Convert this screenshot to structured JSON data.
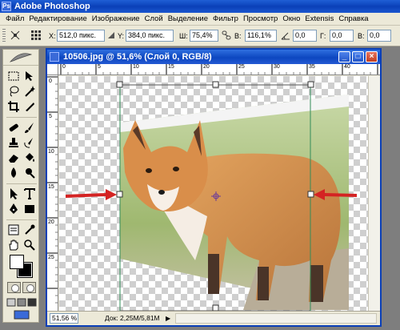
{
  "app": {
    "title": "Adobe Photoshop"
  },
  "menu": [
    "Файл",
    "Редактирование",
    "Изображение",
    "Слой",
    "Выделение",
    "Фильтр",
    "Просмотр",
    "Окно",
    "Extensis",
    "Справка"
  ],
  "options": {
    "x_label": "X:",
    "x_value": "512,0 пикс.",
    "y_label": "Y:",
    "y_value": "384,0 пикс.",
    "w_label": "Ш:",
    "w_value": "75,4%",
    "h_label": "В:",
    "h_value": "116,1%",
    "angle_value": "0,0",
    "hskew_label": "Г:",
    "hskew_value": "0,0",
    "vskew_label": "В:",
    "vskew_value": "0,0"
  },
  "document": {
    "title": "10506.jpg @ 51,6% (Слой 0, RGB/8)",
    "ruler_h": [
      "0",
      "5",
      "10",
      "15",
      "20",
      "25",
      "30",
      "35",
      "40"
    ],
    "ruler_v": [
      "0",
      "5",
      "10",
      "15",
      "20",
      "25"
    ],
    "zoom": "51,56 %",
    "info": "Док: 2,25M/5,81M"
  },
  "colors": {
    "titlebar": "#0a40b8",
    "chrome": "#ece9d8",
    "arrow": "#d42323"
  }
}
